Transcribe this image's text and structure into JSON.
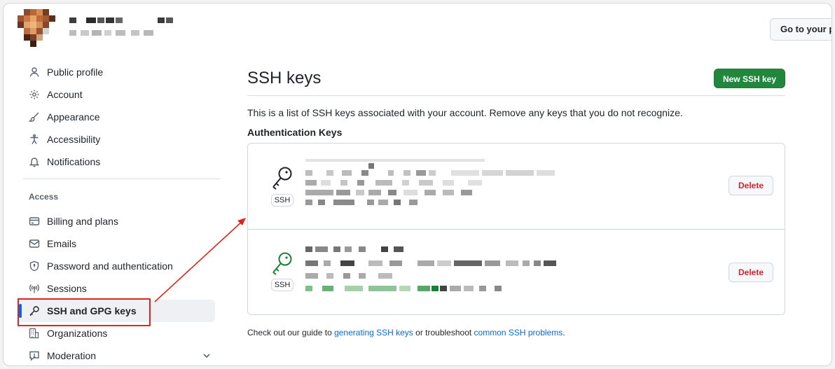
{
  "header": {
    "goto_button": "Go to your pe"
  },
  "sidebar": {
    "items_top": [
      {
        "label": "Public profile",
        "icon": "person-icon"
      },
      {
        "label": "Account",
        "icon": "gear-icon"
      },
      {
        "label": "Appearance",
        "icon": "paintbrush-icon"
      },
      {
        "label": "Accessibility",
        "icon": "accessibility-icon"
      },
      {
        "label": "Notifications",
        "icon": "bell-icon"
      }
    ],
    "access_heading": "Access",
    "items_access": [
      {
        "label": "Billing and plans",
        "icon": "credit-card-icon"
      },
      {
        "label": "Emails",
        "icon": "mail-icon"
      },
      {
        "label": "Password and authentication",
        "icon": "shield-lock-icon"
      },
      {
        "label": "Sessions",
        "icon": "broadcast-icon"
      },
      {
        "label": "SSH and GPG keys",
        "icon": "key-icon",
        "active": true
      },
      {
        "label": "Organizations",
        "icon": "organization-icon"
      },
      {
        "label": "Moderation",
        "icon": "report-icon"
      }
    ]
  },
  "main": {
    "title": "SSH keys",
    "new_button": "New SSH key",
    "description": "This is a list of SSH keys associated with your account. Remove any keys that you do not recognize.",
    "auth_heading": "Authentication Keys",
    "keys": [
      {
        "badge": "SSH",
        "delete_label": "Delete",
        "status_color": "#1f2328"
      },
      {
        "badge": "SSH",
        "delete_label": "Delete",
        "status_color": "#1a7f37"
      }
    ],
    "footer": {
      "prefix": "Check out our guide to ",
      "link1": "generating SSH keys",
      "middle": " or troubleshoot ",
      "link2": "common SSH problems",
      "suffix": "."
    }
  },
  "colors": {
    "accent": "#0969da",
    "primary_button": "#1f883d",
    "danger": "#d1242f",
    "annotation": "#e0241c"
  }
}
